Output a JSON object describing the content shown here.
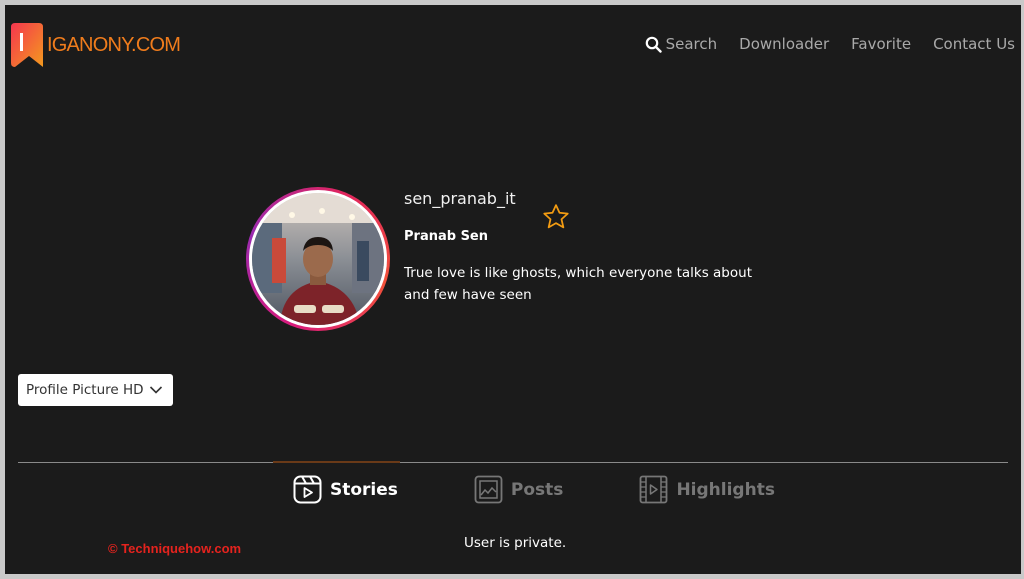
{
  "header": {
    "logo_text": "IGANONY.COM",
    "nav": {
      "search": "Search",
      "downloader": "Downloader",
      "favorite": "Favorite",
      "contact": "Contact Us"
    }
  },
  "profile": {
    "username": "sen_pranab_it",
    "full_name": "Pranab Sen",
    "bio": "True love is like ghosts, which everyone talks about and few have seen"
  },
  "dropdown": {
    "selected": "Profile Picture HD"
  },
  "tabs": {
    "stories": "Stories",
    "posts": "Posts",
    "highlights": "Highlights"
  },
  "content": {
    "message": "User is private."
  },
  "watermark": "© Techniquehow.com",
  "colors": {
    "background": "#1b1b1b",
    "logo": "#f07c1c",
    "nav_text": "#a9a9a9",
    "star": "#f39c12",
    "watermark": "#e5231e"
  },
  "icons": {
    "logo": "bookmark-icon",
    "search": "search-icon",
    "favorite": "star-icon",
    "dropdown": "chevron-down-icon",
    "stories": "reels-icon",
    "posts": "image-icon",
    "highlights": "film-icon"
  }
}
